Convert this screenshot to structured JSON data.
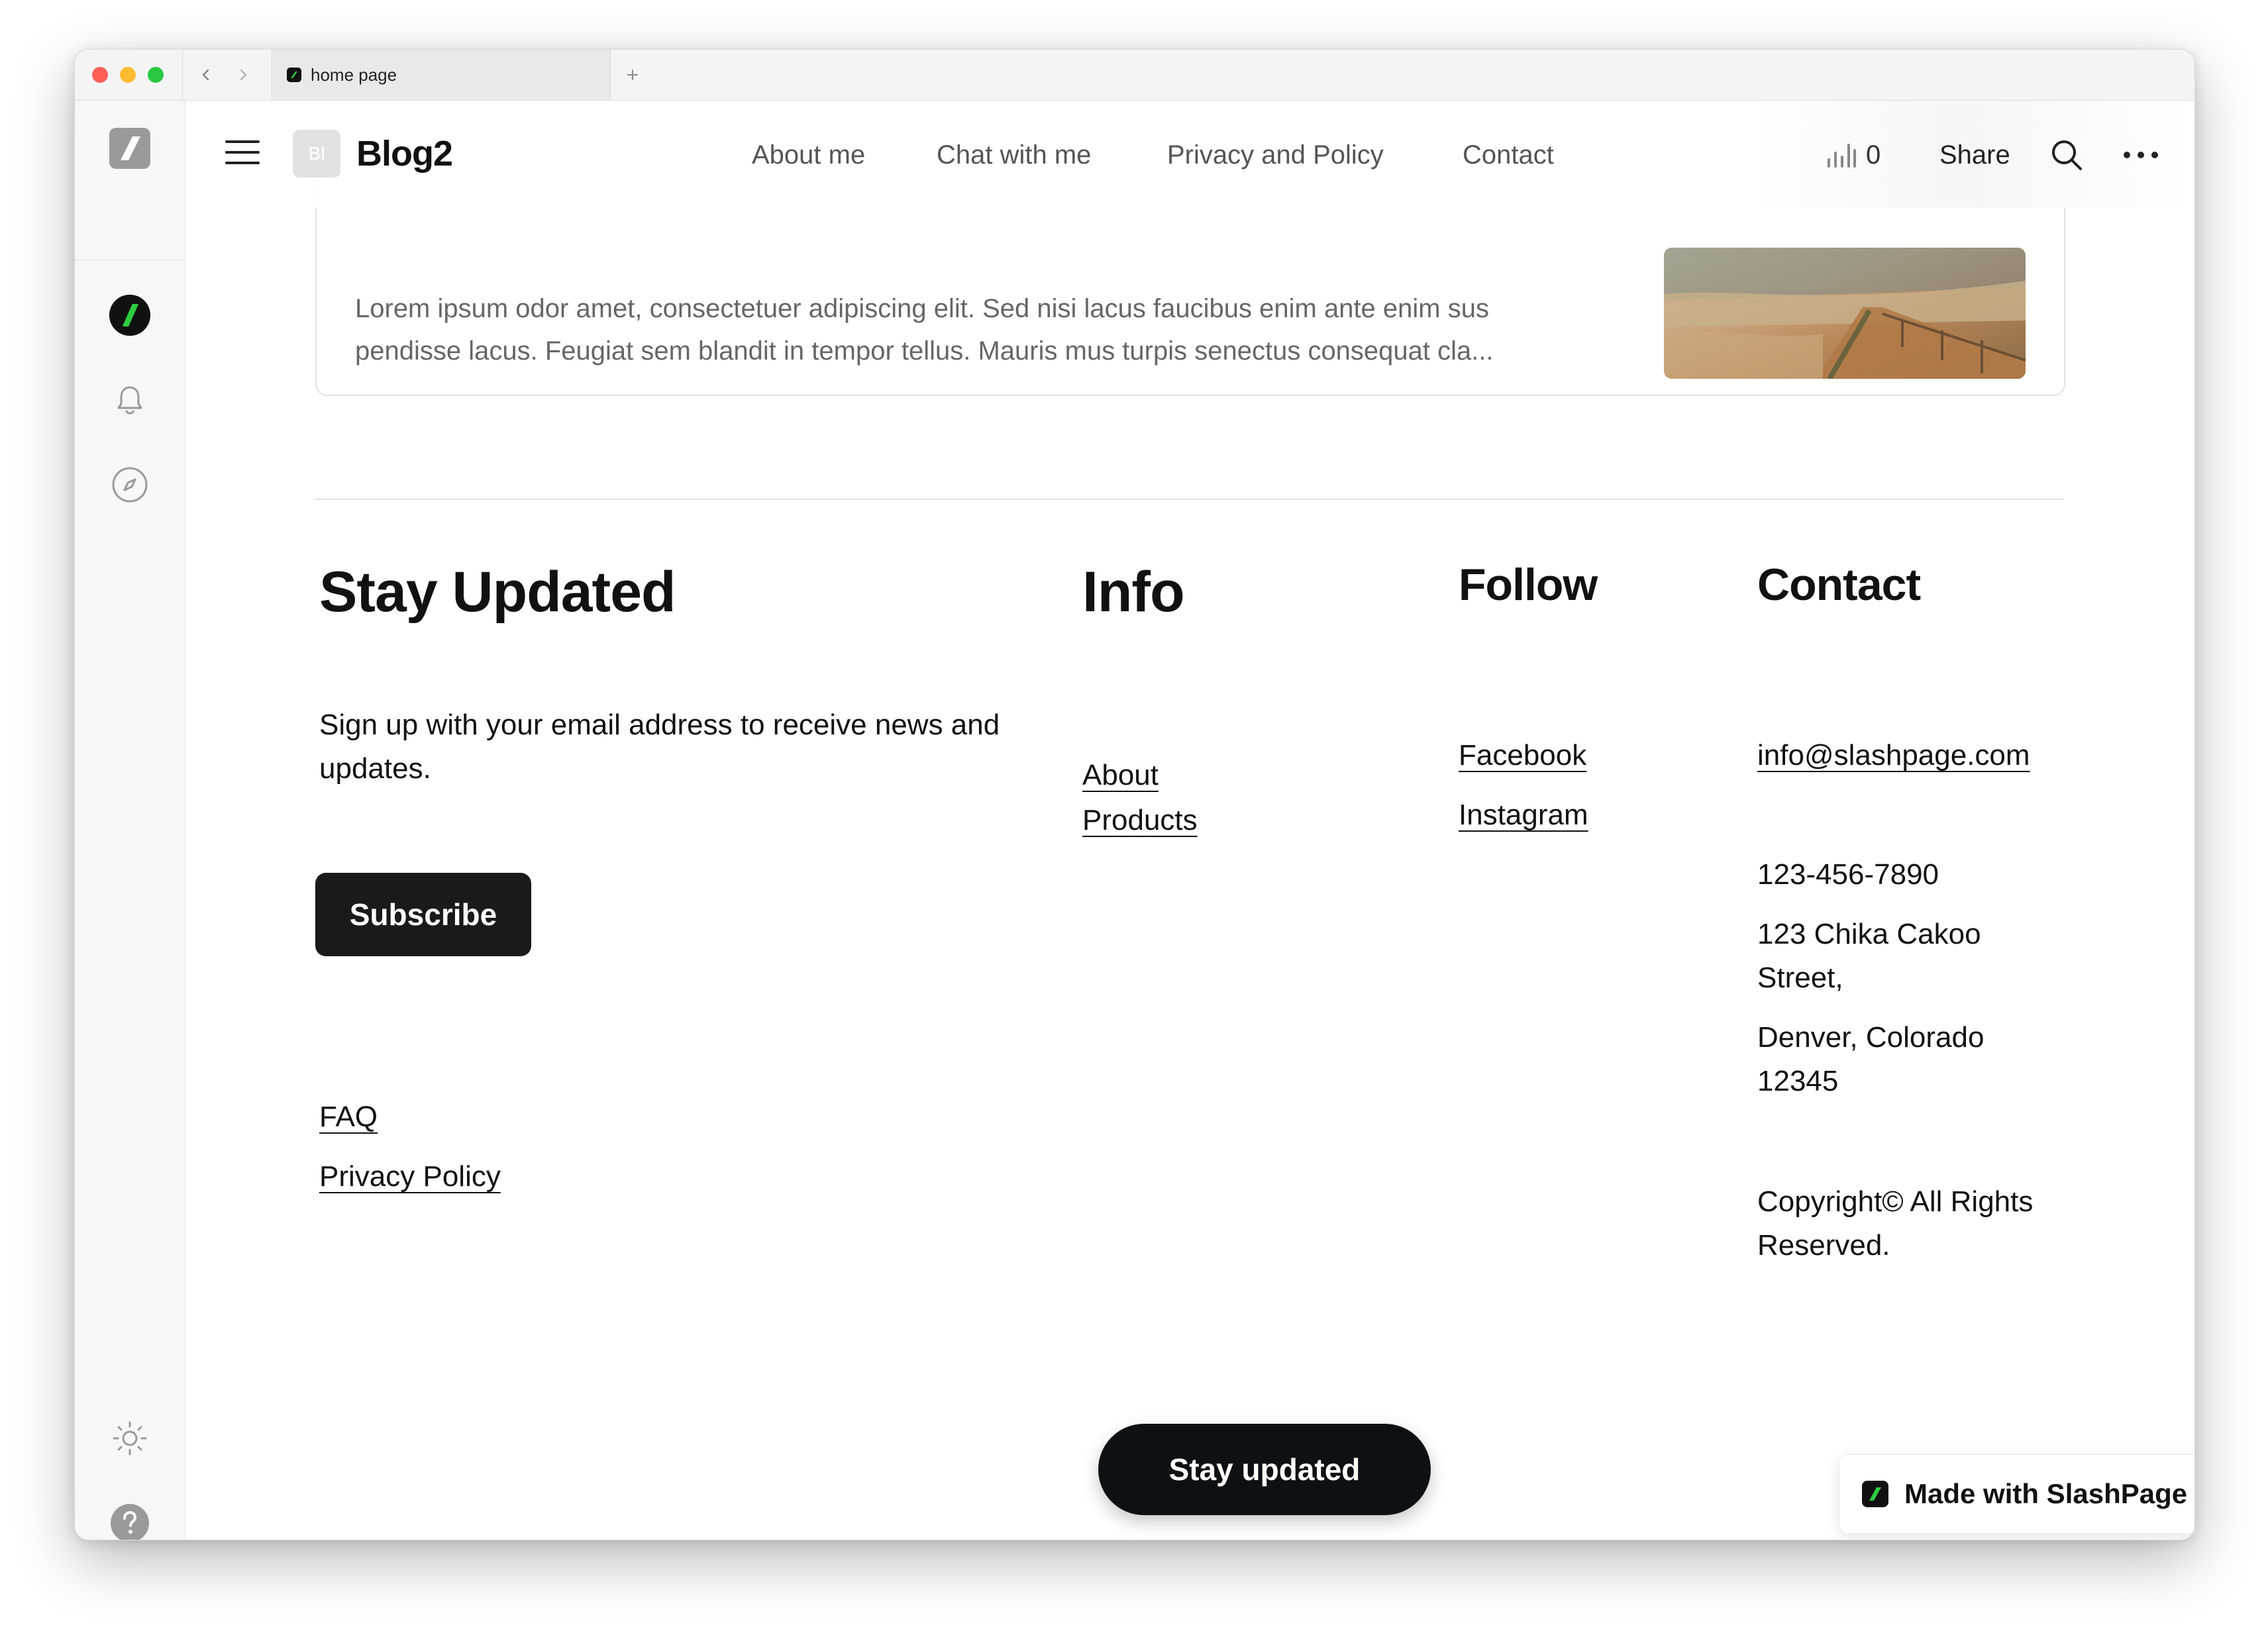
{
  "browser": {
    "tab_title": "home page",
    "new_tab_label": "+"
  },
  "header": {
    "logo_text": "Bl",
    "site_name": "Blog2",
    "menu": [
      "About me",
      "Chat with me",
      "Privacy and Policy",
      "Contact"
    ],
    "views_count": "0",
    "share_label": "Share"
  },
  "card": {
    "excerpt_line1": "Lorem ipsum odor amet, consectetuer adipiscing elit. Sed nisi lacus faucibus enim ante enim sus",
    "excerpt_line2": "pendisse lacus. Feugiat sem blandit in tempor tellus. Mauris mus turpis senectus consequat cla..."
  },
  "footer": {
    "stay_updated": {
      "heading": "Stay Updated",
      "description": "Sign up with your email address to receive news and updates.",
      "subscribe_label": "Subscribe"
    },
    "info": {
      "heading": "Info",
      "links": [
        "About",
        "Products"
      ]
    },
    "follow": {
      "heading": "Follow",
      "links": [
        "Facebook",
        "Instagram"
      ]
    },
    "contact": {
      "heading": "Contact",
      "email": "info@slashpage.com",
      "phone": "123-456-7890",
      "address_line1": "123 Chika Cakoo Street,",
      "address_line2": "Denver, Colorado 12345",
      "copyright": "Copyright© All Rights Reserved."
    },
    "bottom_links": [
      "FAQ",
      "Privacy Policy"
    ]
  },
  "floating": {
    "stay_updated_label": "Stay updated",
    "made_with_label": "Made with SlashPage"
  },
  "colors": {
    "brand_green": "#2ecc40",
    "button_dark": "#1a1a1a",
    "link_text": "#111111"
  },
  "icons": {
    "sidebar": [
      "slashpage-logo-icon",
      "workspace-avatar-icon",
      "bell-icon",
      "compass-icon",
      "sun-icon",
      "help-icon"
    ],
    "header": [
      "menu-icon",
      "bar-chart-icon",
      "search-icon",
      "more-icon"
    ]
  }
}
